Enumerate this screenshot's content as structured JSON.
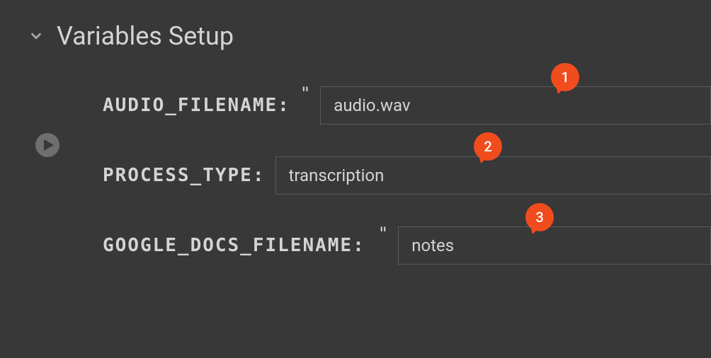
{
  "section": {
    "title": "Variables Setup"
  },
  "vars": {
    "audio_filename": {
      "label": "AUDIO_FILENAME:",
      "value": "audio.wav",
      "badge": "1"
    },
    "process_type": {
      "label": "PROCESS_TYPE:",
      "value": "transcription",
      "badge": "2"
    },
    "google_docs_filename": {
      "label": "GOOGLE_DOCS_FILENAME:",
      "value": "notes",
      "badge": "3"
    }
  }
}
